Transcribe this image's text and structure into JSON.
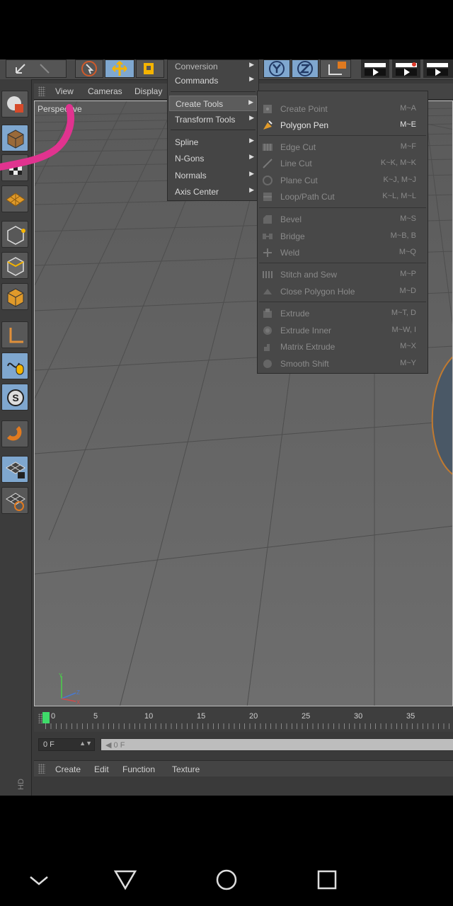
{
  "top_menu_partial": {
    "conversion": "Conversion",
    "commands": "Commands"
  },
  "view_menu": [
    "View",
    "Cameras",
    "Display"
  ],
  "viewport": {
    "label": "Perspective"
  },
  "axis": {
    "y": "Y",
    "z": "Z",
    "x": "X"
  },
  "menu_level1": [
    {
      "label": "Create Tools",
      "highlighted": true
    },
    {
      "label": "Transform Tools"
    },
    {
      "label": "Spline"
    },
    {
      "label": "N-Gons"
    },
    {
      "label": "Normals"
    },
    {
      "label": "Axis Center"
    }
  ],
  "create_tools": [
    {
      "label": "Create Point",
      "shortcut": "M~A",
      "enabled": false,
      "icon": "create-point-icon"
    },
    {
      "label": "Polygon Pen",
      "shortcut": "M~E",
      "enabled": true,
      "icon": "polygon-pen-icon"
    },
    {
      "label": "Edge Cut",
      "shortcut": "M~F",
      "enabled": false,
      "icon": "edge-cut-icon"
    },
    {
      "label": "Line Cut",
      "shortcut": "K~K, M~K",
      "enabled": false,
      "icon": "line-cut-icon"
    },
    {
      "label": "Plane Cut",
      "shortcut": "K~J, M~J",
      "enabled": false,
      "icon": "plane-cut-icon"
    },
    {
      "label": "Loop/Path Cut",
      "shortcut": "K~L, M~L",
      "enabled": false,
      "icon": "loop-cut-icon"
    },
    {
      "label": "Bevel",
      "shortcut": "M~S",
      "enabled": false,
      "icon": "bevel-icon"
    },
    {
      "label": "Bridge",
      "shortcut": "M~B, B",
      "enabled": false,
      "icon": "bridge-icon"
    },
    {
      "label": "Weld",
      "shortcut": "M~Q",
      "enabled": false,
      "icon": "weld-icon"
    },
    {
      "label": "Stitch and Sew",
      "shortcut": "M~P",
      "enabled": false,
      "icon": "stitch-icon"
    },
    {
      "label": "Close Polygon Hole",
      "shortcut": "M~D",
      "enabled": false,
      "icon": "close-hole-icon"
    },
    {
      "label": "Extrude",
      "shortcut": "M~T, D",
      "enabled": false,
      "icon": "extrude-icon"
    },
    {
      "label": "Extrude Inner",
      "shortcut": "M~W, I",
      "enabled": false,
      "icon": "extrude-inner-icon"
    },
    {
      "label": "Matrix Extrude",
      "shortcut": "M~X",
      "enabled": false,
      "icon": "matrix-extrude-icon"
    },
    {
      "label": "Smooth Shift",
      "shortcut": "M~Y",
      "enabled": false,
      "icon": "smooth-shift-icon"
    }
  ],
  "timeline": {
    "ticks": [
      "0",
      "5",
      "10",
      "15",
      "20",
      "25",
      "30",
      "35"
    ],
    "current_frame": "0 F",
    "slider_value": "0 F"
  },
  "bottom_menu": [
    "Create",
    "Edit",
    "Function",
    "Texture"
  ],
  "side_label": "HD",
  "colors": {
    "accent_highlight": "#7fa7cf",
    "playhead": "#3fdc6a",
    "annotation": "#e0338f"
  }
}
